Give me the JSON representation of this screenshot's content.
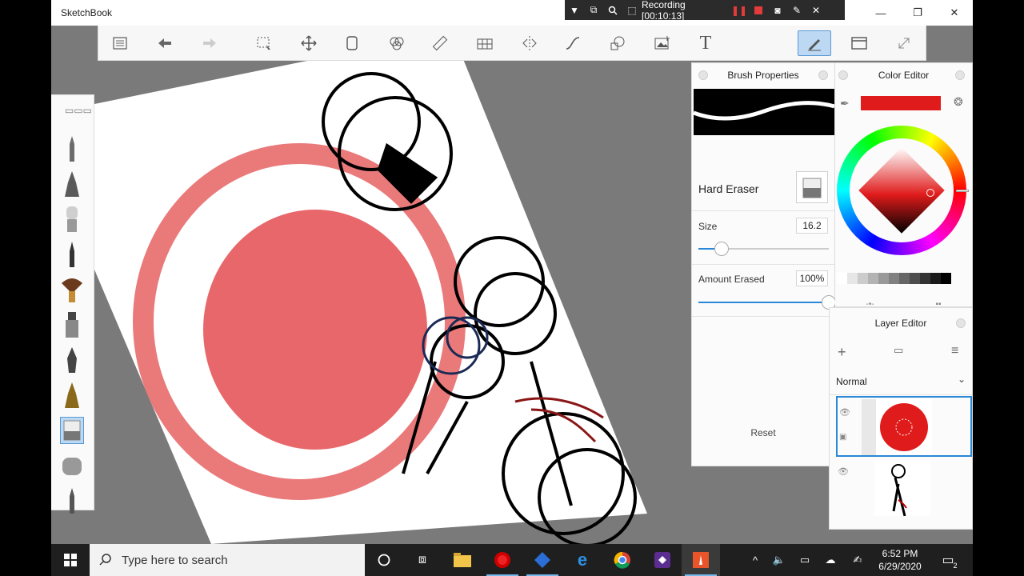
{
  "window": {
    "title": "SketchBook",
    "minimize_glyph": "—",
    "maximize_glyph": "❐",
    "close_glyph": "✕"
  },
  "recording": {
    "label": "Recording [00:10:13]",
    "icons": [
      "dropdown-icon",
      "window-icon",
      "search-icon",
      "region-icon",
      "pause-icon",
      "stop-icon",
      "camera-icon",
      "pen-icon",
      "close-icon"
    ]
  },
  "toolbar": {
    "tools": [
      "lagoon-menu",
      "undo",
      "redo",
      "select",
      "transform",
      "copy-layer",
      "symmetry-colors",
      "ruler",
      "perspective",
      "symmetry",
      "curve",
      "shapes",
      "add-image",
      "text",
      "brush-editor",
      "fullscreen-window",
      "expand"
    ]
  },
  "brush_palette": {
    "menu_glyph": "▭▭▭",
    "brushes": [
      "pencil",
      "ballpoint",
      "soft-brush",
      "fine-pen",
      "fan-brush",
      "marker",
      "ink-pen",
      "calligraphy",
      "hard-eraser",
      "soft-eraser",
      "felt-pen"
    ],
    "selected": "hard-eraser"
  },
  "brush_properties": {
    "title": "Brush Properties",
    "brush_name": "Hard Eraser",
    "size_label": "Size",
    "size_value": "16.2",
    "size_fraction": 0.18,
    "amount_label": "Amount Erased",
    "amount_value": "100%",
    "amount_fraction": 1.0,
    "reset_label": "Reset"
  },
  "color_editor": {
    "title": "Color Editor",
    "current_color": "#e01b1b",
    "grey_swatches": [
      "#ffffff",
      "#e6e6e6",
      "#cccccc",
      "#b3b3b3",
      "#999999",
      "#808080",
      "#666666",
      "#4d4d4d",
      "#333333",
      "#1a1a1a",
      "#000000"
    ]
  },
  "layer_editor": {
    "title": "Layer Editor",
    "blend_mode": "Normal",
    "add_glyph": "+",
    "menu_glyph": "≡",
    "visible_glyph": "👁",
    "layers": [
      {
        "name": "red-layer",
        "selected": true
      },
      {
        "name": "sketch-layer",
        "selected": false
      }
    ]
  },
  "taskbar": {
    "search_placeholder": "Type here to search",
    "time": "6:52 PM",
    "date": "6/29/2020",
    "notification_count": "2",
    "apps": [
      "cortana",
      "task-view",
      "file-explorer",
      "recorder",
      "sketchbook-app",
      "edge",
      "chrome",
      "visual-studio",
      "sketchbook-active"
    ]
  }
}
